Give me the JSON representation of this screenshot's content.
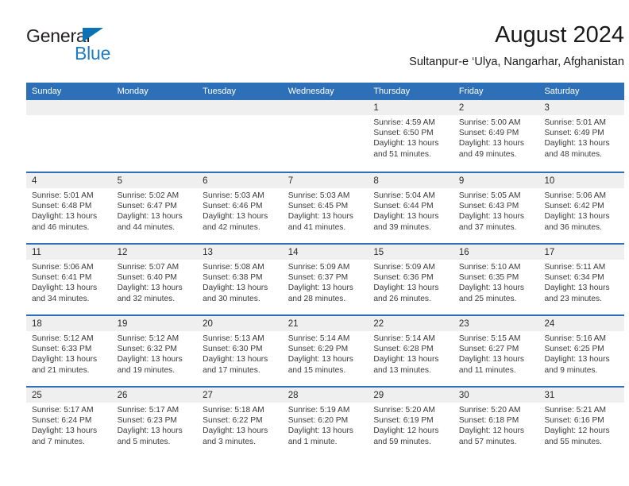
{
  "brand": {
    "name_part1": "General",
    "name_part2": "Blue",
    "triangle_color": "#0b72b5",
    "blue_text_color": "#1f7cc4"
  },
  "header": {
    "title": "August 2024",
    "subtitle": "Sultanpur-e ‘Ulya, Nangarhar, Afghanistan"
  },
  "theme": {
    "header_blue": "#2e70b8",
    "day_band_gray": "#efefef",
    "text_color": "#3a3a3a"
  },
  "weekdays": [
    "Sunday",
    "Monday",
    "Tuesday",
    "Wednesday",
    "Thursday",
    "Friday",
    "Saturday"
  ],
  "weeks": [
    [
      {
        "day": "",
        "lines": [
          "",
          "",
          "",
          ""
        ]
      },
      {
        "day": "",
        "lines": [
          "",
          "",
          "",
          ""
        ]
      },
      {
        "day": "",
        "lines": [
          "",
          "",
          "",
          ""
        ]
      },
      {
        "day": "",
        "lines": [
          "",
          "",
          "",
          ""
        ]
      },
      {
        "day": "1",
        "lines": [
          "Sunrise: 4:59 AM",
          "Sunset: 6:50 PM",
          "Daylight: 13 hours",
          "and 51 minutes."
        ]
      },
      {
        "day": "2",
        "lines": [
          "Sunrise: 5:00 AM",
          "Sunset: 6:49 PM",
          "Daylight: 13 hours",
          "and 49 minutes."
        ]
      },
      {
        "day": "3",
        "lines": [
          "Sunrise: 5:01 AM",
          "Sunset: 6:49 PM",
          "Daylight: 13 hours",
          "and 48 minutes."
        ]
      }
    ],
    [
      {
        "day": "4",
        "lines": [
          "Sunrise: 5:01 AM",
          "Sunset: 6:48 PM",
          "Daylight: 13 hours",
          "and 46 minutes."
        ]
      },
      {
        "day": "5",
        "lines": [
          "Sunrise: 5:02 AM",
          "Sunset: 6:47 PM",
          "Daylight: 13 hours",
          "and 44 minutes."
        ]
      },
      {
        "day": "6",
        "lines": [
          "Sunrise: 5:03 AM",
          "Sunset: 6:46 PM",
          "Daylight: 13 hours",
          "and 42 minutes."
        ]
      },
      {
        "day": "7",
        "lines": [
          "Sunrise: 5:03 AM",
          "Sunset: 6:45 PM",
          "Daylight: 13 hours",
          "and 41 minutes."
        ]
      },
      {
        "day": "8",
        "lines": [
          "Sunrise: 5:04 AM",
          "Sunset: 6:44 PM",
          "Daylight: 13 hours",
          "and 39 minutes."
        ]
      },
      {
        "day": "9",
        "lines": [
          "Sunrise: 5:05 AM",
          "Sunset: 6:43 PM",
          "Daylight: 13 hours",
          "and 37 minutes."
        ]
      },
      {
        "day": "10",
        "lines": [
          "Sunrise: 5:06 AM",
          "Sunset: 6:42 PM",
          "Daylight: 13 hours",
          "and 36 minutes."
        ]
      }
    ],
    [
      {
        "day": "11",
        "lines": [
          "Sunrise: 5:06 AM",
          "Sunset: 6:41 PM",
          "Daylight: 13 hours",
          "and 34 minutes."
        ]
      },
      {
        "day": "12",
        "lines": [
          "Sunrise: 5:07 AM",
          "Sunset: 6:40 PM",
          "Daylight: 13 hours",
          "and 32 minutes."
        ]
      },
      {
        "day": "13",
        "lines": [
          "Sunrise: 5:08 AM",
          "Sunset: 6:38 PM",
          "Daylight: 13 hours",
          "and 30 minutes."
        ]
      },
      {
        "day": "14",
        "lines": [
          "Sunrise: 5:09 AM",
          "Sunset: 6:37 PM",
          "Daylight: 13 hours",
          "and 28 minutes."
        ]
      },
      {
        "day": "15",
        "lines": [
          "Sunrise: 5:09 AM",
          "Sunset: 6:36 PM",
          "Daylight: 13 hours",
          "and 26 minutes."
        ]
      },
      {
        "day": "16",
        "lines": [
          "Sunrise: 5:10 AM",
          "Sunset: 6:35 PM",
          "Daylight: 13 hours",
          "and 25 minutes."
        ]
      },
      {
        "day": "17",
        "lines": [
          "Sunrise: 5:11 AM",
          "Sunset: 6:34 PM",
          "Daylight: 13 hours",
          "and 23 minutes."
        ]
      }
    ],
    [
      {
        "day": "18",
        "lines": [
          "Sunrise: 5:12 AM",
          "Sunset: 6:33 PM",
          "Daylight: 13 hours",
          "and 21 minutes."
        ]
      },
      {
        "day": "19",
        "lines": [
          "Sunrise: 5:12 AM",
          "Sunset: 6:32 PM",
          "Daylight: 13 hours",
          "and 19 minutes."
        ]
      },
      {
        "day": "20",
        "lines": [
          "Sunrise: 5:13 AM",
          "Sunset: 6:30 PM",
          "Daylight: 13 hours",
          "and 17 minutes."
        ]
      },
      {
        "day": "21",
        "lines": [
          "Sunrise: 5:14 AM",
          "Sunset: 6:29 PM",
          "Daylight: 13 hours",
          "and 15 minutes."
        ]
      },
      {
        "day": "22",
        "lines": [
          "Sunrise: 5:14 AM",
          "Sunset: 6:28 PM",
          "Daylight: 13 hours",
          "and 13 minutes."
        ]
      },
      {
        "day": "23",
        "lines": [
          "Sunrise: 5:15 AM",
          "Sunset: 6:27 PM",
          "Daylight: 13 hours",
          "and 11 minutes."
        ]
      },
      {
        "day": "24",
        "lines": [
          "Sunrise: 5:16 AM",
          "Sunset: 6:25 PM",
          "Daylight: 13 hours",
          "and 9 minutes."
        ]
      }
    ],
    [
      {
        "day": "25",
        "lines": [
          "Sunrise: 5:17 AM",
          "Sunset: 6:24 PM",
          "Daylight: 13 hours",
          "and 7 minutes."
        ]
      },
      {
        "day": "26",
        "lines": [
          "Sunrise: 5:17 AM",
          "Sunset: 6:23 PM",
          "Daylight: 13 hours",
          "and 5 minutes."
        ]
      },
      {
        "day": "27",
        "lines": [
          "Sunrise: 5:18 AM",
          "Sunset: 6:22 PM",
          "Daylight: 13 hours",
          "and 3 minutes."
        ]
      },
      {
        "day": "28",
        "lines": [
          "Sunrise: 5:19 AM",
          "Sunset: 6:20 PM",
          "Daylight: 13 hours",
          "and 1 minute."
        ]
      },
      {
        "day": "29",
        "lines": [
          "Sunrise: 5:20 AM",
          "Sunset: 6:19 PM",
          "Daylight: 12 hours",
          "and 59 minutes."
        ]
      },
      {
        "day": "30",
        "lines": [
          "Sunrise: 5:20 AM",
          "Sunset: 6:18 PM",
          "Daylight: 12 hours",
          "and 57 minutes."
        ]
      },
      {
        "day": "31",
        "lines": [
          "Sunrise: 5:21 AM",
          "Sunset: 6:16 PM",
          "Daylight: 12 hours",
          "and 55 minutes."
        ]
      }
    ]
  ]
}
